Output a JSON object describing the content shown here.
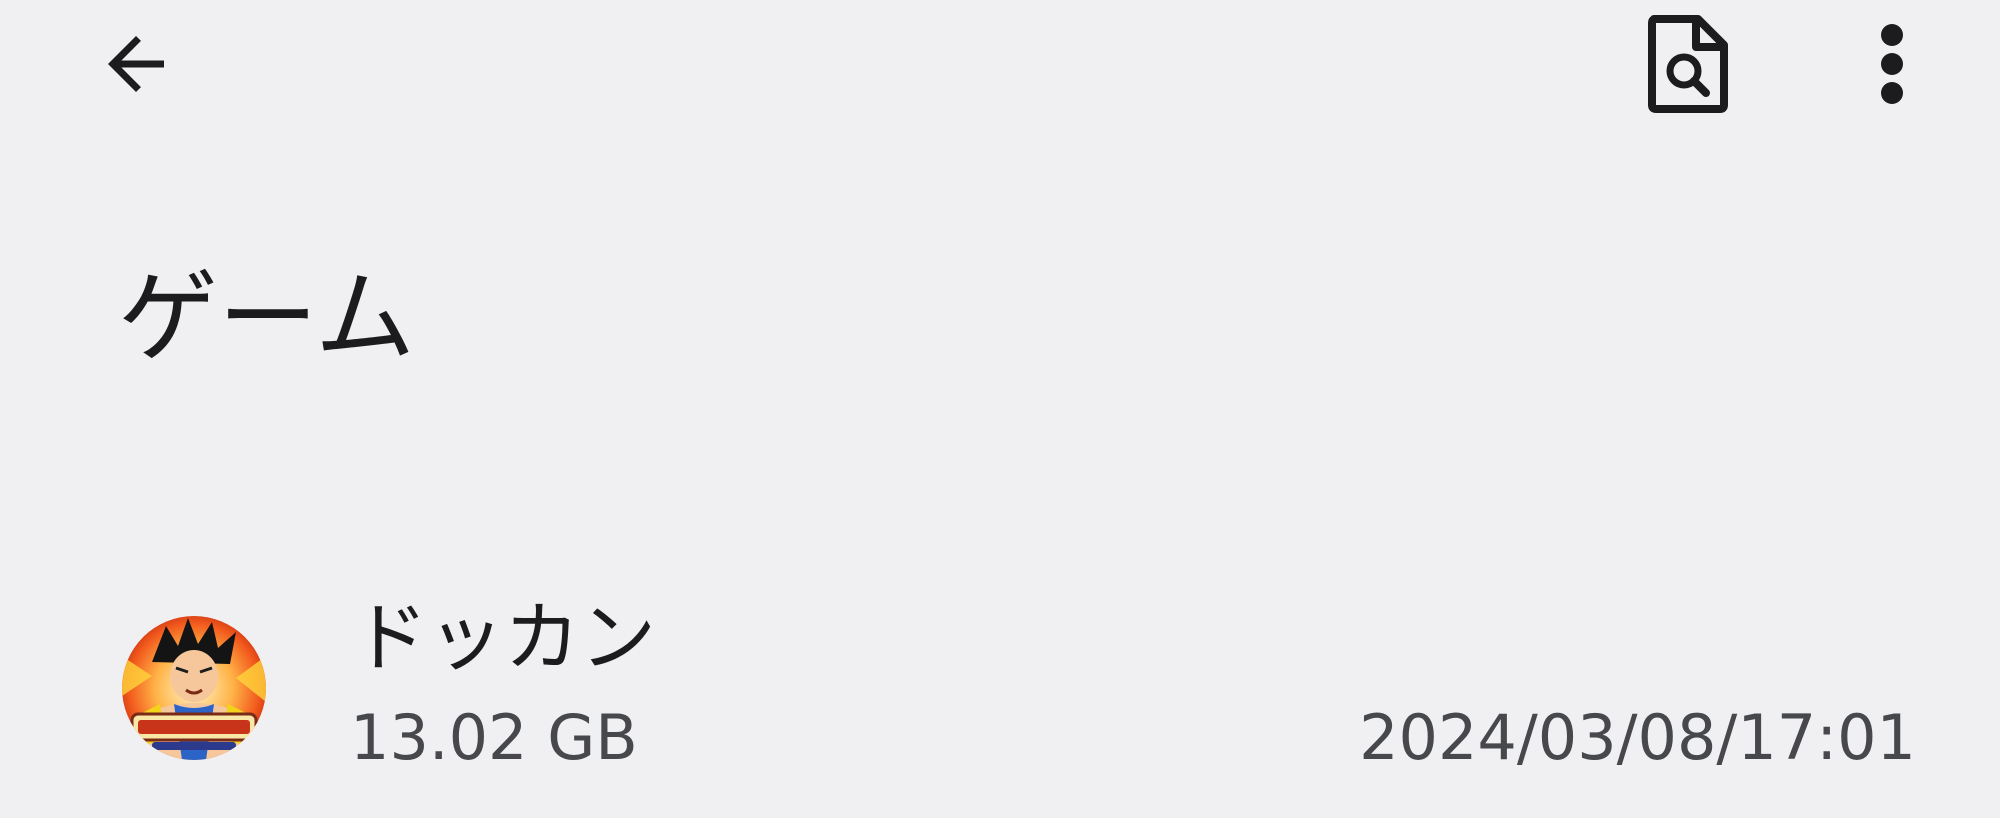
{
  "toolbar": {
    "back_icon": "arrow-back-icon",
    "preview_icon": "file-search-icon",
    "more_icon": "more-vert-icon"
  },
  "page": {
    "title": "ゲーム"
  },
  "items": [
    {
      "name": "ドッカン",
      "size": "13.02 GB",
      "date": "2024/03/08/17:01",
      "icon": "dokkan-battle-app-icon"
    }
  ],
  "colors": {
    "background": "#f0f0f3",
    "primary_text": "#1c1c1e",
    "secondary_text": "#46484c",
    "icon": "#1c1c1e"
  }
}
